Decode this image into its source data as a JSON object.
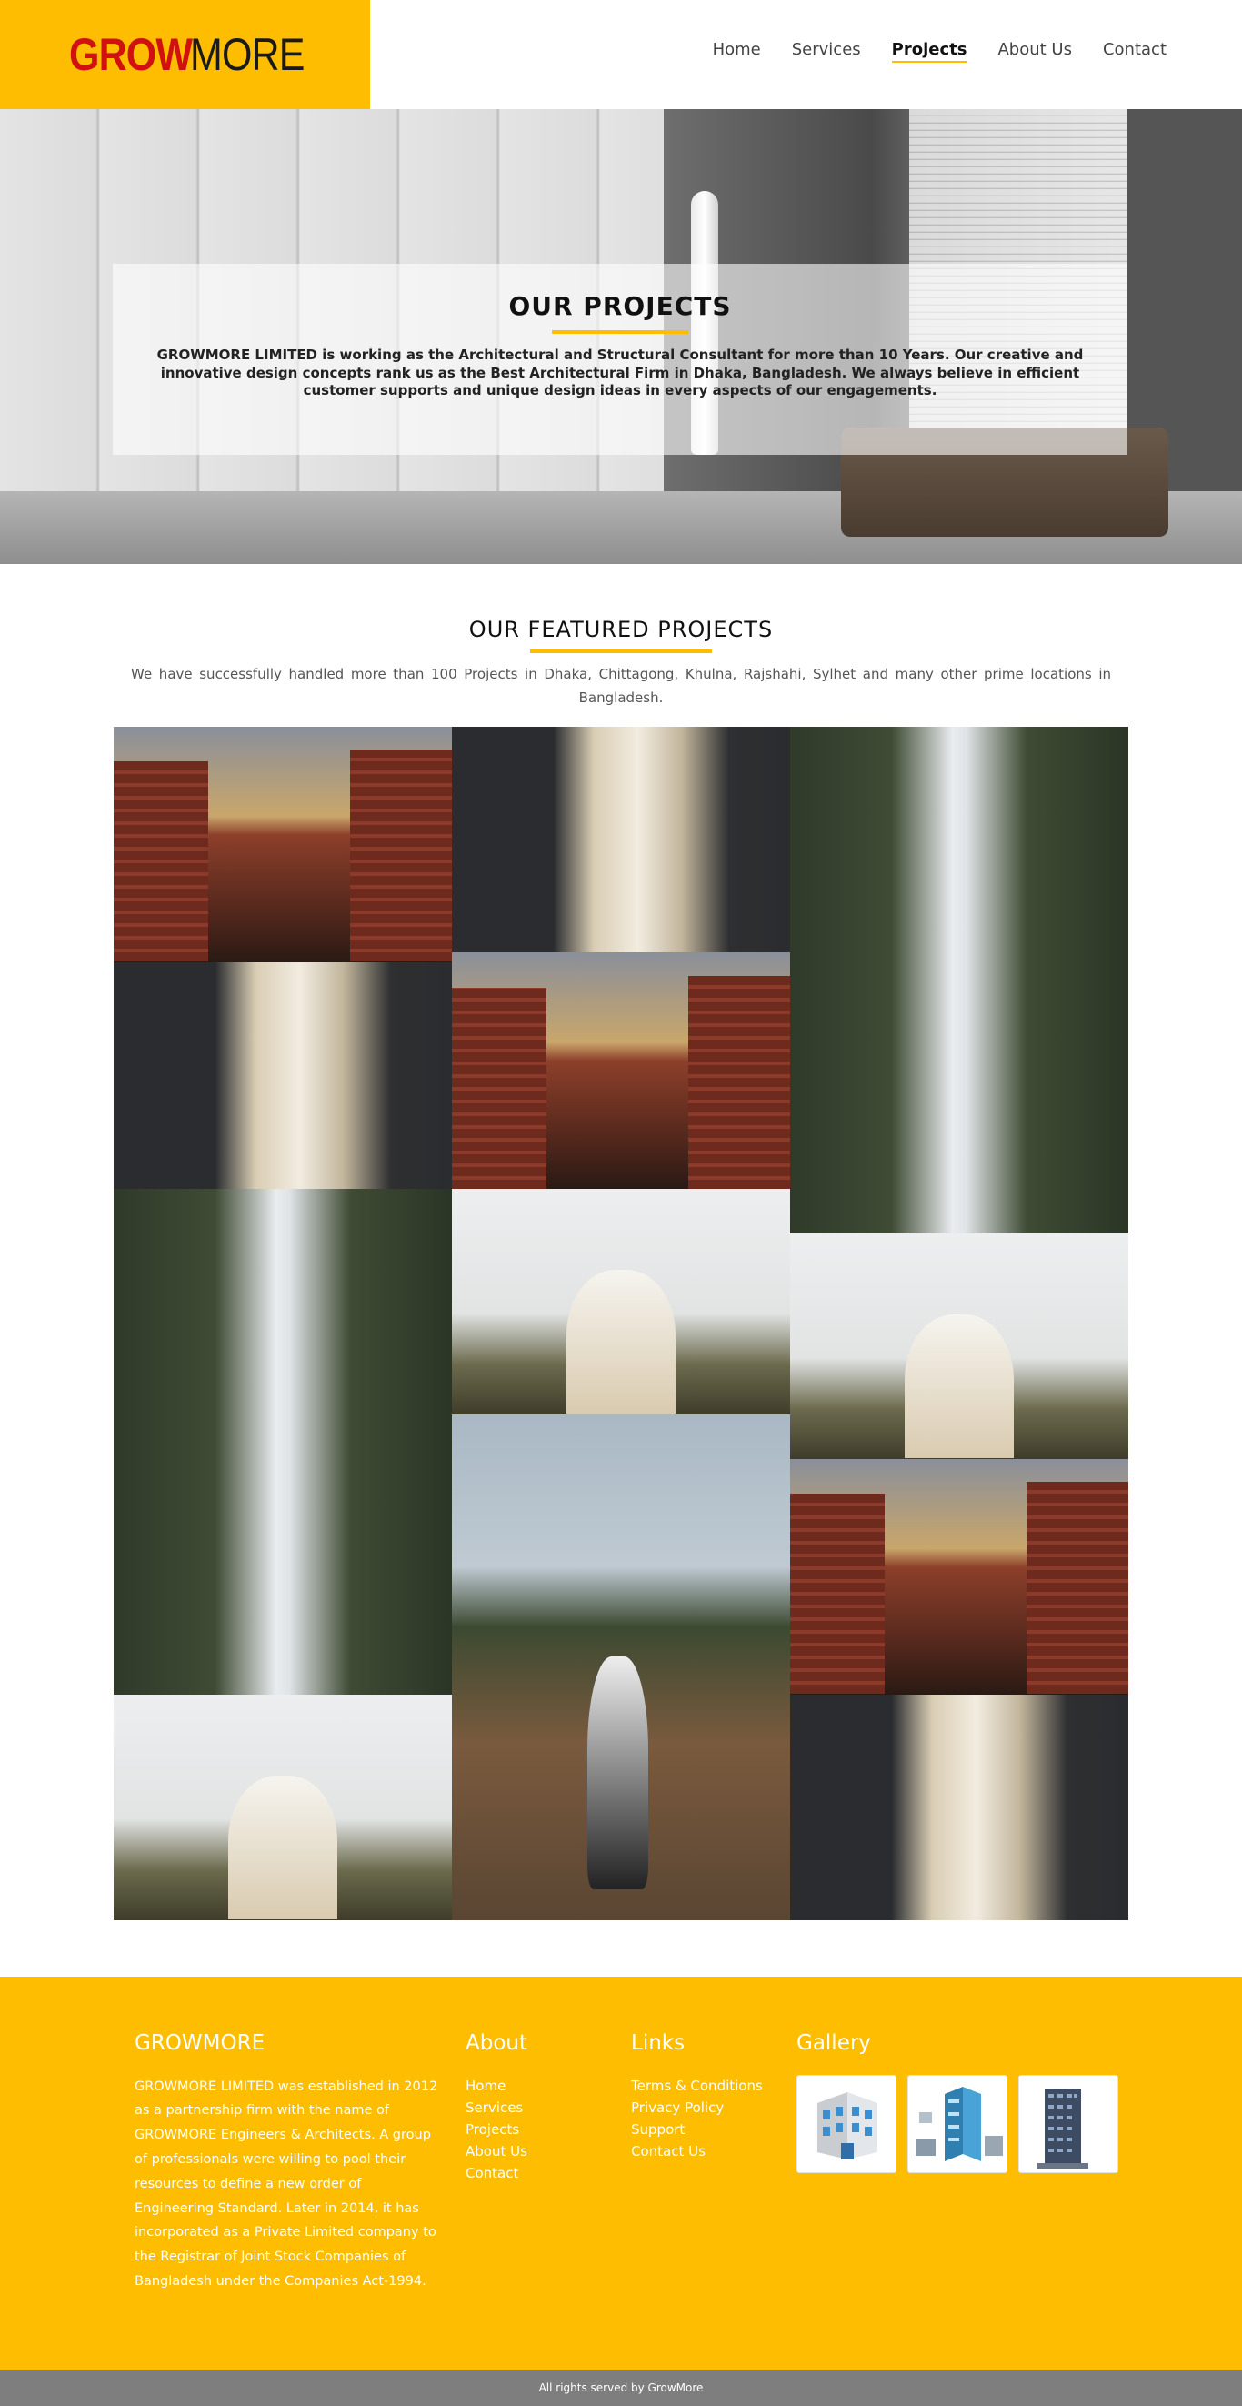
{
  "header": {
    "logo_part1": "GROW",
    "logo_part2": "MORE",
    "nav": [
      "Home",
      "Services",
      "Projects",
      "About Us",
      "Contact"
    ],
    "active_nav": "Projects"
  },
  "hero": {
    "title": "OUR PROJECTS",
    "text": "GROWMORE LIMITED is working as the Architectural and Structural Consultant for more than 10 Years. Our creative and innovative design concepts rank us as the Best Architectural Firm in Dhaka, Bangladesh. We always believe in efficient customer supports and unique design ideas in every aspects of our engagements."
  },
  "featured": {
    "title": "OUR FEATURED PROJECTS",
    "text": "We have successfully handled more than 100 Projects in Dhaka, Chittagong, Khulna, Rajshahi, Sylhet and many other prime locations in Bangladesh."
  },
  "gallery": [
    {
      "subject": "building-canal",
      "col": 1
    },
    {
      "subject": "clothes-rack",
      "col": 1
    },
    {
      "subject": "waterfall",
      "col": 1
    },
    {
      "subject": "veiled-woman",
      "col": 1
    },
    {
      "subject": "clothes-rack",
      "col": 2
    },
    {
      "subject": "building-canal",
      "col": 2
    },
    {
      "subject": "veiled-woman",
      "col": 2
    },
    {
      "subject": "woman-on-rock",
      "col": 2
    },
    {
      "subject": "waterfall",
      "col": 3
    },
    {
      "subject": "veiled-woman",
      "col": 3
    },
    {
      "subject": "building-canal",
      "col": 3
    },
    {
      "subject": "clothes-rack",
      "col": 3
    }
  ],
  "footer": {
    "brand_title": "GROWMORE",
    "brand_text": "GROWMORE LIMITED was established in 2012 as a partnership firm with the name of GROWMORE Engineers & Architects. A group of professionals were willing to pool their resources to define a new order of Engineering Standard. Later in 2014, it has incorporated as a Private Limited company to the Registrar of Joint Stock Companies of Bangladesh under the Companies Act-1994.",
    "about_title": "About",
    "about_links": [
      "Home",
      "Services",
      "Projects",
      "About Us",
      "Contact"
    ],
    "links_title": "Links",
    "links": [
      "Terms & Conditions",
      "Privacy Policy",
      "Support",
      "Contact Us"
    ],
    "gallery_title": "Gallery",
    "gallery_thumbs": [
      "building-icon",
      "building-cluster-icon",
      "skyscraper-icon"
    ]
  },
  "copyright": "All rights served by GrowMore",
  "colors": {
    "accent": "#ffbd00",
    "logo_red": "#d0110f",
    "copyright_bg": "#7e7e7e"
  }
}
